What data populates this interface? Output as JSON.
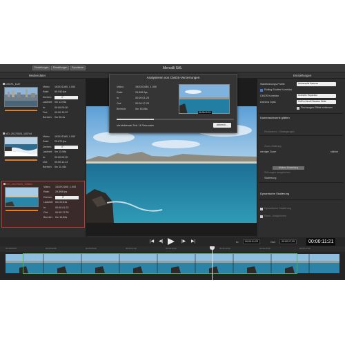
{
  "window": {
    "title": "Mercalli SAL",
    "top_buttons": [
      "Einstellungen",
      "Einstellungen",
      "Exportieren"
    ]
  },
  "panels": {
    "media_title": "Mediendatei",
    "settings_title": "Einstellungen"
  },
  "media_clips": [
    {
      "name": "DSCF1_1187",
      "video": "1920X1080, 1.000",
      "rate": "59.940 fps",
      "drehen": "0°",
      "laufzeit": "0m 13.05s",
      "in": "00:00:00:00",
      "out": "00:00:10:22",
      "bereich": "0m 08.4s",
      "selected": false
    },
    {
      "name": "VID_20170525_105744",
      "video": "1920X1080, 1.000",
      "rate": "29.870 fps",
      "drehen": "0°",
      "laufzeit": "0m 15.58s",
      "in": "00:00:00:00",
      "out": "00:00:11:14",
      "bereich": "0m 11.44s",
      "selected": false
    },
    {
      "name": "VID_20170525_105801",
      "video": "1920X1080, 1.000",
      "rate": "29.898 fps",
      "drehen": "0°",
      "laufzeit": "0m 20.64s",
      "in": "00:00:01:23",
      "out": "00:00:17:29",
      "bereich": "0m 16.86s",
      "selected": true
    }
  ],
  "clip_labels": {
    "video": "Video:",
    "rate": "Rate:",
    "drehen": "Drehen:",
    "laufzeit": "Laufzeit:",
    "in": "In:",
    "out": "Out:",
    "bereich": "Bereich:"
  },
  "modal": {
    "title": "Analysieren von CMOS-Verzerrungen",
    "rows": [
      {
        "label": "Video:",
        "value": "1920X1080, 1.000"
      },
      {
        "label": "Rate:",
        "value": "29.898 fps"
      },
      {
        "label": "In:",
        "value": "00:00:01:23"
      },
      {
        "label": "Out:",
        "value": "00:00:17:29"
      },
      {
        "label": "Bereich:",
        "value": "0m 16.86s"
      }
    ],
    "thumb_timecode": "00:00:11:21",
    "progress": 0.32,
    "remaining": "Verbleibende Zeit: 16 Sekunden",
    "abort_label": "Abbrech..."
  },
  "settings": {
    "profile_label": "Stabilisierungs-Profile",
    "profile_value": "Universelle Kamera",
    "rolling_shutter": "Rolling Shutter Korrektur",
    "cmos_label": "CMOS Korrektur",
    "cmos_value": "Schnelle Reparatur",
    "kamera_label": "Kamera Optik",
    "kamera_value": "GoPro Hero3 Session Wide",
    "fisheye": "Fischaugen Effekt entfernen",
    "kameraschwenk": "Kameraschwenk glätten",
    "schwenk_sub": "Reduzieren - Bewegungen",
    "zoom_sub": "Zoom-Glättung",
    "weniger": "weniger Zoom",
    "starker": "stärker",
    "weitere": "Weitere Einstellung",
    "stoerung": "Störungen ausgleichen",
    "skalierung": "Skalierung",
    "dyn_skalierung": "Dynamische Skalierung",
    "opt1": "Dynamische Skalierung",
    "opt2": "Rand - Ausgleichen"
  },
  "controls": {
    "in_label": "In:",
    "in_tc": "00:00:01:23",
    "out_label": "Out:",
    "out_tc": "00:00:17:29",
    "current_tc": "00:00:11:21"
  },
  "timeline": {
    "ticks": [
      "00:00:00:00",
      "00:00:02:00",
      "00:00:05:00",
      "00:00:07:00",
      "00:00:10:00",
      "00:00:12:00",
      "00:00:15:00",
      "00:00:17:00"
    ]
  },
  "colors": {
    "accent_orange": "#e67e22",
    "selected_red": "#c0392b",
    "range_green": "#4caf50",
    "checkbox_blue": "#3b7ddd"
  }
}
